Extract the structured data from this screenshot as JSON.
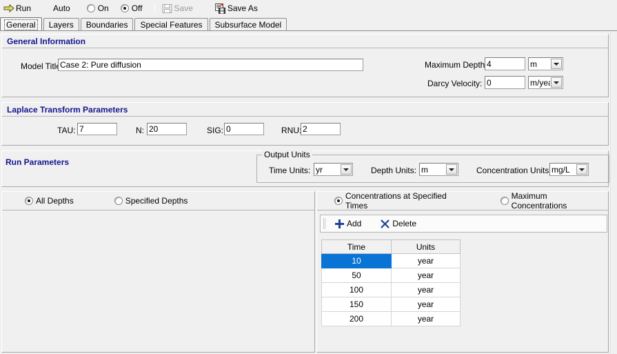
{
  "toolbar": {
    "run_label": "Run",
    "auto_label": "Auto",
    "auto_on_label": "On",
    "auto_off_label": "Off",
    "auto_selected": "Off",
    "save_label": "Save",
    "save_as_label": "Save As",
    "run_icon": "right-arrow-icon",
    "save_icon": "floppy-disk-icon",
    "save_as_icon": "save-as-icon"
  },
  "tabs": [
    {
      "label": "General",
      "active": true
    },
    {
      "label": "Layers",
      "active": false
    },
    {
      "label": "Boundaries",
      "active": false
    },
    {
      "label": "Special Features",
      "active": false
    },
    {
      "label": "Subsurface Model",
      "active": false
    }
  ],
  "general_information": {
    "title": "General Information",
    "model_title_label": "Model Title:",
    "model_title_value": "Case 2: Pure diffusion",
    "maximum_depth_label": "Maximum Depth:",
    "maximum_depth_value": "4",
    "maximum_depth_unit": "m",
    "darcy_velocity_label": "Darcy Velocity:",
    "darcy_velocity_value": "0",
    "darcy_velocity_unit": "m/year"
  },
  "laplace": {
    "title": "Laplace Transform Parameters",
    "tau_label": "TAU:",
    "tau_value": "7",
    "n_label": "N:",
    "n_value": "20",
    "sig_label": "SIG:",
    "sig_value": "0",
    "rnu_label": "RNU:",
    "rnu_value": "2"
  },
  "run_parameters": {
    "title": "Run Parameters",
    "output_units_legend": "Output Units",
    "time_units_label": "Time Units:",
    "time_units_value": "yr",
    "depth_units_label": "Depth Units:",
    "depth_units_value": "m",
    "concentration_units_label": "Concentration Units:",
    "concentration_units_value": "mg/L"
  },
  "depth_panel": {
    "all_depths_label": "All Depths",
    "specified_depths_label": "Specified Depths",
    "selected": "All Depths"
  },
  "times_panel": {
    "concentrations_at_specified_times_label": "Concentrations at Specified Times",
    "maximum_concentrations_label": "Maximum Concentrations",
    "selected": "Concentrations at Specified Times",
    "add_label": "Add",
    "delete_label": "Delete",
    "grid": {
      "columns": [
        "Time",
        "Units"
      ],
      "rows": [
        {
          "time": "10",
          "units": "year",
          "selected": true
        },
        {
          "time": "50",
          "units": "year",
          "selected": false
        },
        {
          "time": "100",
          "units": "year",
          "selected": false
        },
        {
          "time": "150",
          "units": "year",
          "selected": false
        },
        {
          "time": "200",
          "units": "year",
          "selected": false
        }
      ]
    }
  },
  "colors": {
    "section_header_text": "#141490",
    "selection_blue": "#0a74d4",
    "toolbar_icon_blue": "#1b3f9c",
    "run_arrow": "#d8d24a",
    "window_background": "#f0f0f0"
  }
}
